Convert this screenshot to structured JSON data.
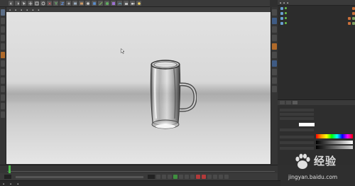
{
  "watermark": {
    "brand_text": "经验",
    "url_text": "jingyan.baidu.com"
  },
  "colors": {
    "viewport_top": "#e2e2e2",
    "viewport_horizon": "#bdbdbd",
    "panel_bg": "#2e2e2e",
    "timeline_marker": "#4bb94b"
  },
  "icons": {
    "cursor": "mouse-pointer-icon",
    "mug": "glass-mug-render",
    "logo": "baidu-paw-icon"
  }
}
